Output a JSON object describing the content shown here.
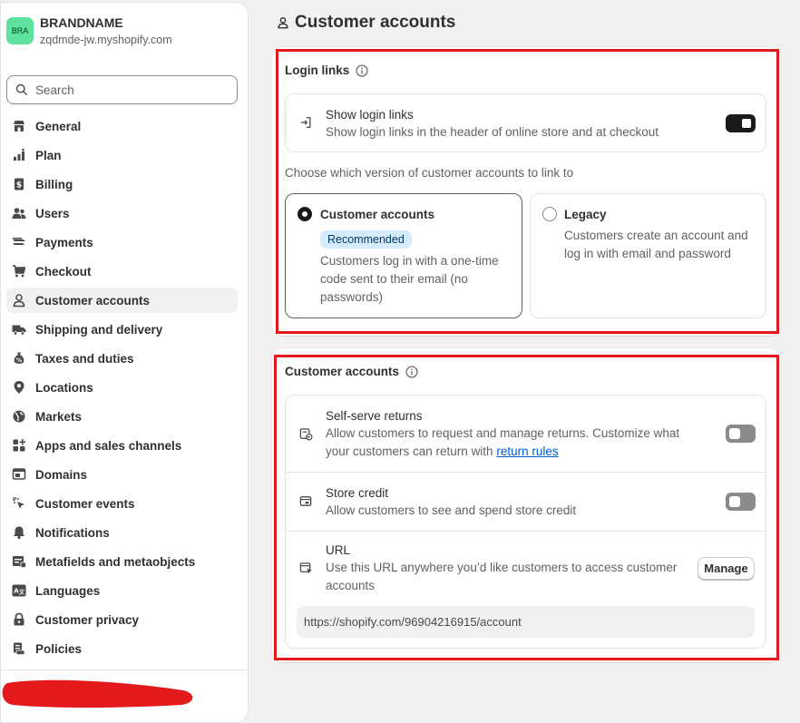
{
  "store": {
    "avatar": "BRA",
    "name": "BRANDNAME",
    "domain": "zqdmde-jw.myshopify.com"
  },
  "search": {
    "placeholder": "Search"
  },
  "nav": [
    {
      "label": "General",
      "icon": "store-icon"
    },
    {
      "label": "Plan",
      "icon": "plan-icon"
    },
    {
      "label": "Billing",
      "icon": "billing-icon"
    },
    {
      "label": "Users",
      "icon": "users-icon"
    },
    {
      "label": "Payments",
      "icon": "payments-icon"
    },
    {
      "label": "Checkout",
      "icon": "cart-icon"
    },
    {
      "label": "Customer accounts",
      "icon": "person-icon",
      "active": true
    },
    {
      "label": "Shipping and delivery",
      "icon": "truck-icon"
    },
    {
      "label": "Taxes and duties",
      "icon": "tax-icon"
    },
    {
      "label": "Locations",
      "icon": "location-pin-icon"
    },
    {
      "label": "Markets",
      "icon": "globe-icon"
    },
    {
      "label": "Apps and sales channels",
      "icon": "apps-icon"
    },
    {
      "label": "Domains",
      "icon": "domains-icon"
    },
    {
      "label": "Customer events",
      "icon": "cursor-click-icon"
    },
    {
      "label": "Notifications",
      "icon": "bell-icon"
    },
    {
      "label": "Metafields and metaobjects",
      "icon": "metafields-icon"
    },
    {
      "label": "Languages",
      "icon": "language-icon"
    },
    {
      "label": "Customer privacy",
      "icon": "lock-icon"
    },
    {
      "label": "Policies",
      "icon": "policies-icon"
    }
  ],
  "page": {
    "title": "Customer accounts"
  },
  "login_links": {
    "title": "Login links",
    "show": {
      "title": "Show login links",
      "desc": "Show login links in the header of online store and at checkout",
      "enabled": true
    },
    "choose_label": "Choose which version of customer accounts to link to",
    "options": [
      {
        "title": "Customer accounts",
        "badge": "Recommended",
        "desc": "Customers log in with a one-time code sent to their email (no passwords)",
        "selected": true
      },
      {
        "title": "Legacy",
        "desc": "Customers create an account and log in with email and password",
        "selected": false
      }
    ]
  },
  "customer_accounts": {
    "title": "Customer accounts",
    "self_serve": {
      "title": "Self-serve returns",
      "desc": "Allow customers to request and manage returns. Customize what your customers can return with",
      "link": "return rules",
      "enabled": false
    },
    "store_credit": {
      "title": "Store credit",
      "desc": "Allow customers to see and spend store credit",
      "enabled": false
    },
    "url": {
      "title": "URL",
      "desc": "Use this URL anywhere you’d like customers to access customer accounts",
      "button": "Manage",
      "value": "https://shopify.com/96904216915/account"
    }
  },
  "colors": {
    "highlight": "#e3191c",
    "accent": "#1a1a1a",
    "badge_bg": "#d5ebff",
    "link": "#005bd3",
    "avatar_bg": "#5ee29d"
  }
}
